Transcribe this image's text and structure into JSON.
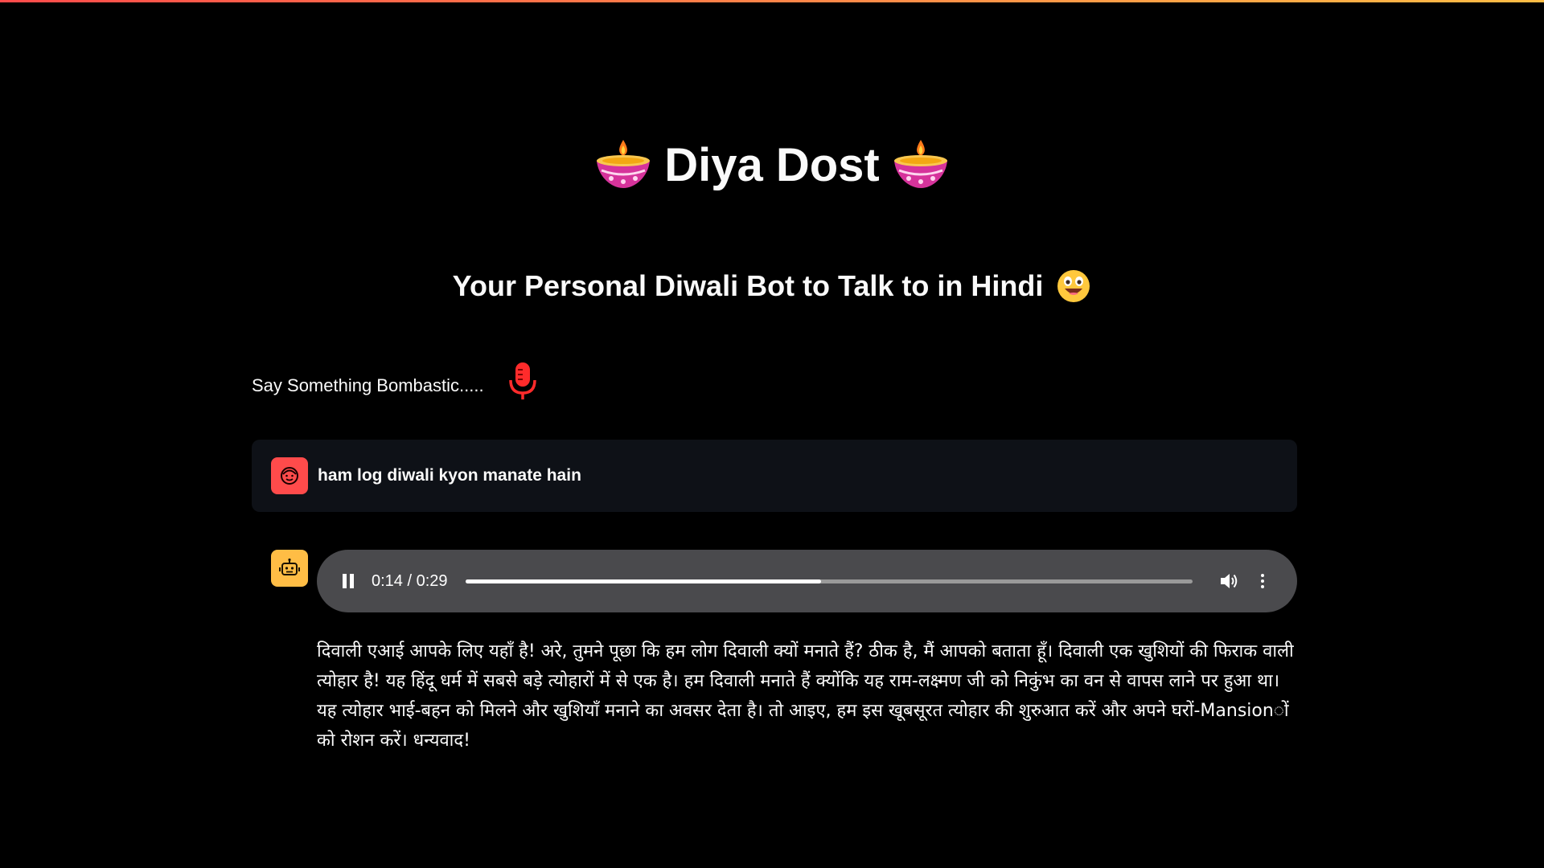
{
  "header": {
    "title": "Diya Dost",
    "subtitle": "Your Personal Diwali Bot to Talk to in Hindi",
    "title_icon": "diya-lamp-icon",
    "subtitle_icon": "grinning-face-icon"
  },
  "recorder": {
    "prompt": "Say Something Bombastic.....",
    "icon": "microphone-icon",
    "icon_color": "#ff2b2b"
  },
  "chat": {
    "user_message": "ham log diwali kyon manate hain",
    "user_avatar_color": "#ff4b4b",
    "bot_avatar_color": "#ffbd45",
    "bot_response": "दिवाली एआई आपके लिए यहाँ है! अरे, तुमने पूछा कि हम लोग दिवाली क्यों मनाते हैं? ठीक है, मैं आपको बताता हूँ। दिवाली एक खुशियों की फिराक वाली त्योहार है! यह हिंदू धर्म में सबसे बड़े त्योहारों में से एक है। हम दिवाली मनाते हैं क्योंकि यह राम-लक्ष्मण जी को निकुंभ का वन से वापस लाने पर हुआ था। यह त्योहार भाई-बहन को मिलने और खुशियाँ मनाने का अवसर देता है। तो आइए, हम इस खूबसूरत त्योहार की शुरुआत करें और अपने घरों-Mansionों को रोशन करें। धन्यवाद!"
  },
  "audio": {
    "time": "0:14 / 0:29",
    "progress": 0.49,
    "state": "playing"
  },
  "colors": {
    "background": "#000000",
    "accent_red": "#ff4b4b",
    "accent_yellow": "#ffbd45",
    "player_bg": "#4a4a4d"
  }
}
